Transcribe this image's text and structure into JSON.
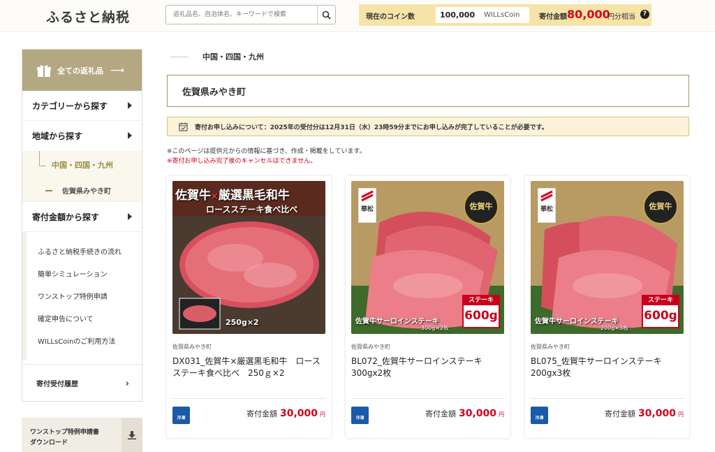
{
  "header": {
    "logo": "ふるさと納税",
    "search_placeholder": "返礼品名、自治体名、キーワードで検索",
    "coin_label": "現在のコイン数",
    "coin_value": "100,000",
    "coin_unit": "WILLsCoin",
    "donation_label": "寄付金額",
    "donation_value": "80,000",
    "donation_unit": "円分相当",
    "help_glyph": "?"
  },
  "sidebar": {
    "all_items": "全ての返礼品",
    "category": "カテゴリーから探す",
    "region": "地域から探す",
    "region_selected": "中国・四国・九州",
    "municipality": "佐賀県みやき町",
    "amount": "寄付金額から探す",
    "links": [
      "ふるさと納税手続きの流れ",
      "簡単シミュレーション",
      "ワンストップ特例申請",
      "確定申告について",
      "WILLsCoinのご利用方法"
    ],
    "history": "寄付受付履歴",
    "download_line1": "ワンストップ特例申請書",
    "download_line2": "ダウンロード"
  },
  "breadcrumb": {
    "current": "中国・四国・九州"
  },
  "page_title": "佐賀県みやき町",
  "notice": "寄付お申し込みについて：2025年の受付分は12月31日（水）23時59分までにお申し込みが完了していることが必要です。",
  "note1": "※このページは提供元からの情報に基づき、作成・掲載をしています。",
  "note2": "※寄付お申し込み完了後のキャンセルはできません。",
  "products": [
    {
      "municipality": "佐賀県みやき町",
      "name": "DX031_佐賀牛×厳選黒毛和牛　ロースステーキ食べ比べ　250ｇ×2",
      "price_label": "寄付金額",
      "price": "30,000",
      "price_unit": "円",
      "freeze": "冷凍",
      "img_title1": "佐賀牛",
      "img_title_x": "×",
      "img_title2": "厳選黒毛和牛",
      "img_sub": "ロースステーキ食べ比べ",
      "img_weight": "250g×2"
    },
    {
      "municipality": "佐賀県みやき町",
      "name": "BL072_佐賀牛サーロインステーキ300gx2枚",
      "price_label": "寄付金額",
      "price": "30,000",
      "price_unit": "円",
      "freeze": "冷凍",
      "brand": "華松",
      "seal": "佐賀牛",
      "img_cap": "佐賀牛サーロインステーキ",
      "img_weight": "300g×2枚",
      "tag_top": "ステーキ",
      "tag_big": "600g"
    },
    {
      "municipality": "佐賀県みやき町",
      "name": "BL075_佐賀牛サーロインステーキ200gx3枚",
      "price_label": "寄付金額",
      "price": "30,000",
      "price_unit": "円",
      "freeze": "冷凍",
      "brand": "華松",
      "seal": "佐賀牛",
      "img_cap": "佐賀牛サーロインステーキ",
      "img_weight": "200g×3枚",
      "tag_top": "ステーキ",
      "tag_big": "600g"
    }
  ],
  "colors": {
    "accent": "#b4a883",
    "price": "#d6001c",
    "freeze": "#1a5aa8",
    "coinbar": "#f5e3a8"
  },
  "icons": [
    "search-icon",
    "gift-icon",
    "calendar-check-icon",
    "download-icon",
    "freeze-icon"
  ]
}
